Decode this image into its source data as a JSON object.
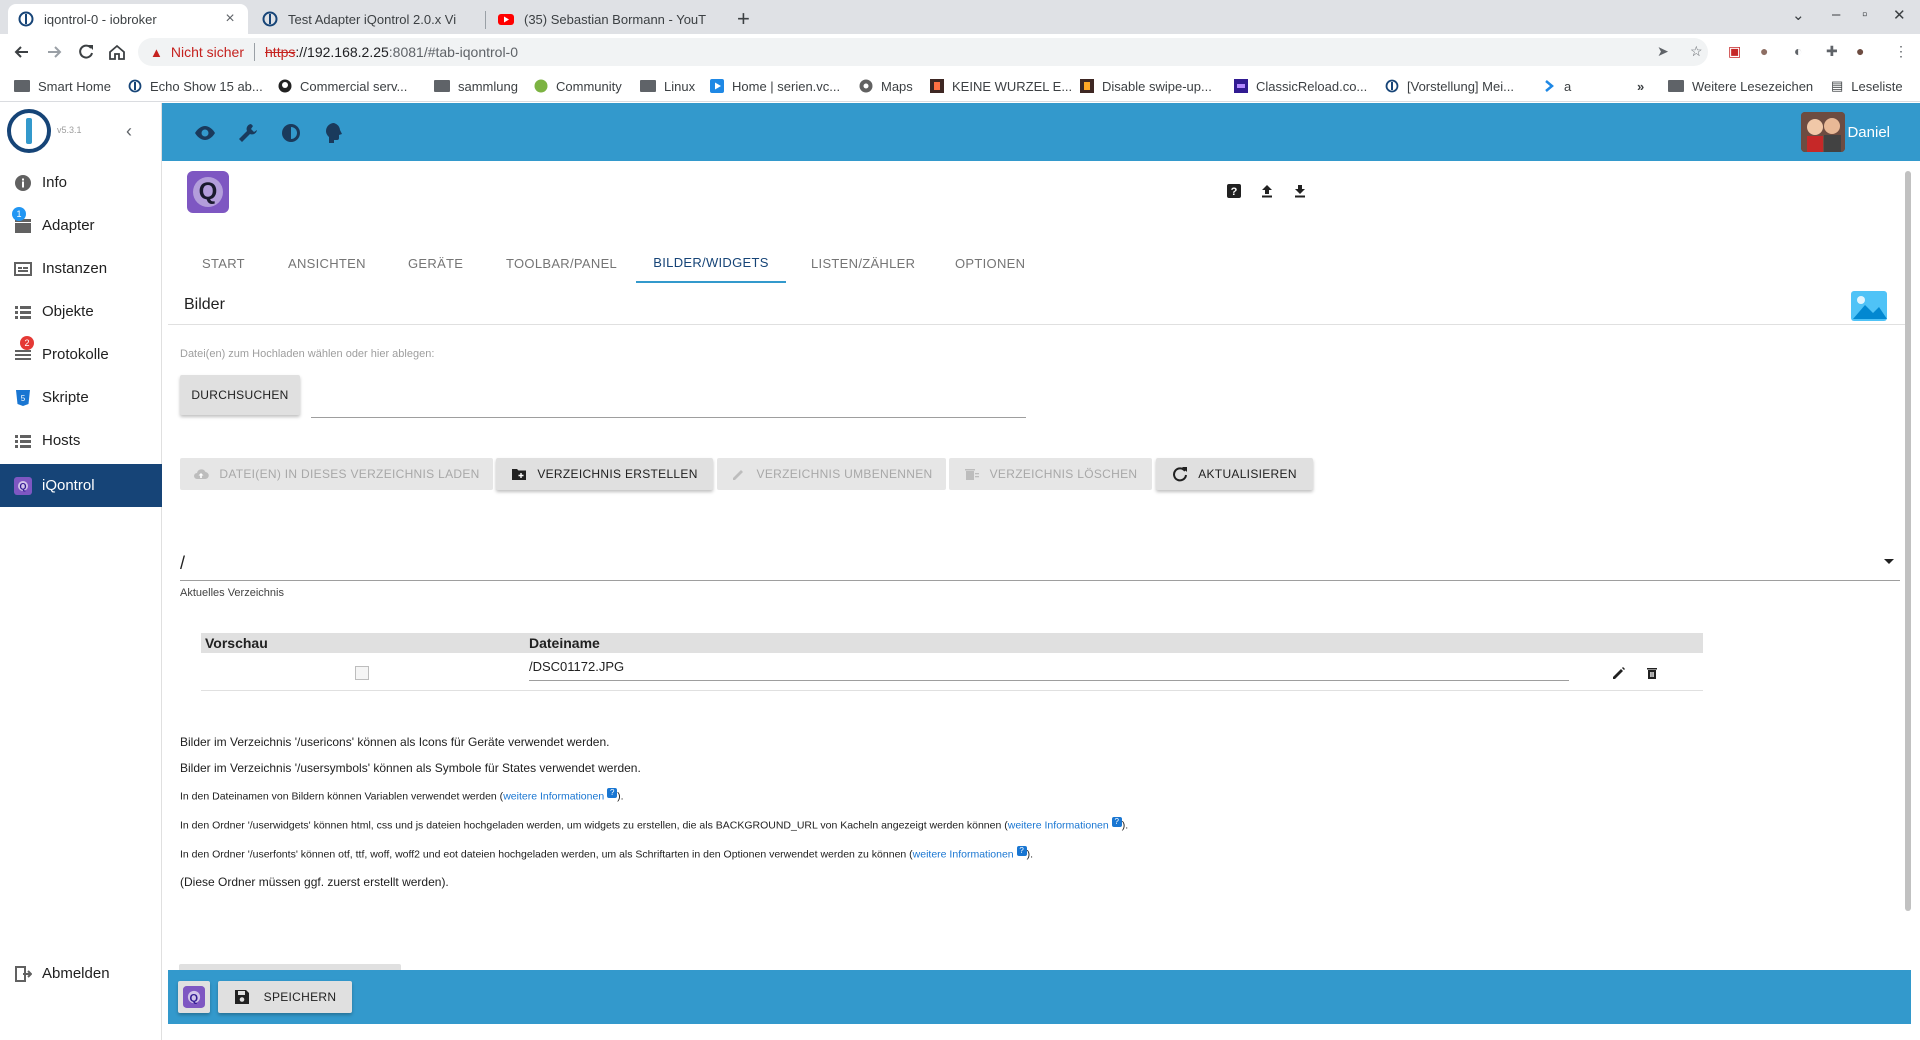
{
  "browser": {
    "tabs": [
      {
        "title": "iqontrol-0 - iobroker",
        "active": true
      },
      {
        "title": "Test Adapter iQontrol 2.0.x Vi",
        "active": false
      },
      {
        "title": "(35) Sebastian Bormann - YouT",
        "active": false
      }
    ],
    "address": {
      "security_label": "Nicht sicher",
      "scheme": "https",
      "host": "://192.168.2.25",
      "rest": ":8081/#tab-iqontrol-0"
    },
    "bookmarks": [
      {
        "label": "Smart Home",
        "icon": "folder-icon"
      },
      {
        "label": "Echo Show 15 ab...",
        "icon": "iobroker-icon"
      },
      {
        "label": "Commercial serv...",
        "icon": "github-icon"
      },
      {
        "label": "sammlung",
        "icon": "folder-icon"
      },
      {
        "label": "Community",
        "icon": "community-icon"
      },
      {
        "label": "Linux",
        "icon": "folder-icon"
      },
      {
        "label": "Home | serien.vc...",
        "icon": "play-icon"
      },
      {
        "label": "Maps",
        "icon": "maps-icon"
      },
      {
        "label": "KEINE WURZEL E...",
        "icon": "site-icon"
      },
      {
        "label": "Disable swipe-up...",
        "icon": "site-icon"
      },
      {
        "label": "ClassicReload.co...",
        "icon": "site-icon"
      },
      {
        "label": "[Vorstellung] Mei...",
        "icon": "iobroker-icon"
      },
      {
        "label": "a",
        "icon": "chevron-icon"
      }
    ],
    "more_bookmarks": "»",
    "other_bookmarks": "Weitere Lesezeichen",
    "reading_list": "Leseliste"
  },
  "sidebar": {
    "version": "v5.3.1",
    "items": [
      {
        "label": "Info",
        "icon": "info-icon"
      },
      {
        "label": "Adapter",
        "icon": "store-icon",
        "badge": "1",
        "badge_color": "#2196f3"
      },
      {
        "label": "Instanzen",
        "icon": "instances-icon"
      },
      {
        "label": "Objekte",
        "icon": "list-icon"
      },
      {
        "label": "Protokolle",
        "icon": "logs-icon",
        "badge": "2",
        "badge_color": "#e53935"
      },
      {
        "label": "Skripte",
        "icon": "script-icon"
      },
      {
        "label": "Hosts",
        "icon": "hosts-icon"
      },
      {
        "label": "iQontrol",
        "icon": "iqontrol-icon",
        "active": true
      }
    ],
    "logout": "Abmelden"
  },
  "topbar": {
    "user_name": "Daniel",
    "accent": "#3399cc"
  },
  "tabs": [
    "START",
    "ANSICHTEN",
    "GERÄTE",
    "TOOLBAR/PANEL",
    "BILDER/WIDGETS",
    "LISTEN/ZÄHLER",
    "OPTIONEN"
  ],
  "selected_tab": "BILDER/WIDGETS",
  "section": {
    "title": "Bilder",
    "upload_label": "Datei(en) zum Hochladen wählen oder hier ablegen:",
    "browse_button": "DURCHSUCHEN",
    "actions": [
      {
        "label": "DATEI(EN) IN DIESES VERZEICHNIS LADEN",
        "enabled": false,
        "icon": "cloud-upload-icon"
      },
      {
        "label": "VERZEICHNIS ERSTELLEN",
        "enabled": true,
        "icon": "create-folder-icon"
      },
      {
        "label": "VERZEICHNIS UMBENENNEN",
        "enabled": false,
        "icon": "pencil-icon"
      },
      {
        "label": "VERZEICHNIS LÖSCHEN",
        "enabled": false,
        "icon": "delete-folder-icon"
      },
      {
        "label": "AKTUALISIEREN",
        "enabled": true,
        "icon": "refresh-icon"
      }
    ],
    "current_dir": "/",
    "current_dir_label": "Aktuelles Verzeichnis"
  },
  "files": {
    "columns": [
      "Vorschau",
      "Dateiname"
    ],
    "rows": [
      {
        "filename": "/DSC01172.JPG"
      }
    ]
  },
  "info": {
    "line1": "Bilder im Verzeichnis '/usericons' können als Icons für Geräte verwendet werden.",
    "line2": "Bilder im Verzeichnis '/usersymbols' können als Symbole für States verwendet werden.",
    "line3_pre": "In den Dateinamen von Bildern können Variablen verwendet werden (",
    "line4_pre": "In den Ordner '/userwidgets' können html, css und js dateien hochgeladen werden, um widgets zu erstellen, die als BACKGROUND_URL von Kacheln angezeigt werden können (",
    "line5_pre": "In den Ordner '/userfonts' können otf, ttf, woff, woff2 und eot dateien hochgeladen werden, um als Schriftarten in den Optionen verwendet werden zu können (",
    "link": "weitere Informationen",
    "qmark": "?",
    "close": ").",
    "line6": "(Diese Ordner müssen ggf. zuerst erstellt werden)."
  },
  "footer": {
    "save_button": "SPEICHERN"
  }
}
